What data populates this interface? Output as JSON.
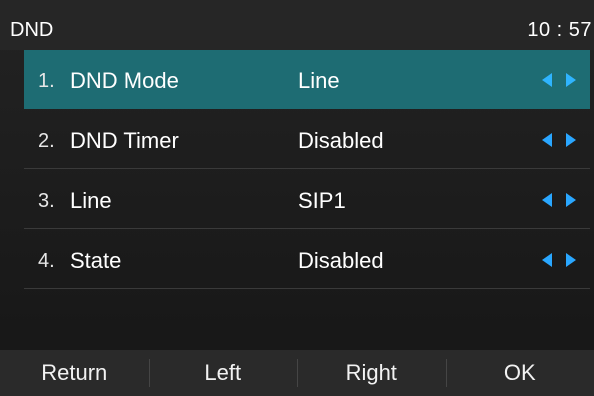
{
  "header": {
    "title": "DND",
    "time": "10 : 57"
  },
  "rows": [
    {
      "num": "1.",
      "label": "DND Mode",
      "value": "Line",
      "selected": true
    },
    {
      "num": "2.",
      "label": "DND Timer",
      "value": "Disabled",
      "selected": false
    },
    {
      "num": "3.",
      "label": "Line",
      "value": "SIP1",
      "selected": false
    },
    {
      "num": "4.",
      "label": "State",
      "value": "Disabled",
      "selected": false
    }
  ],
  "icons": {
    "left": "arrow-left-icon",
    "right": "arrow-right-icon"
  },
  "colors": {
    "selected_row": "#1e6c73",
    "arrow": "#2aa7ff"
  },
  "softkeys": [
    {
      "label": "Return"
    },
    {
      "label": "Left"
    },
    {
      "label": "Right"
    },
    {
      "label": "OK"
    }
  ]
}
